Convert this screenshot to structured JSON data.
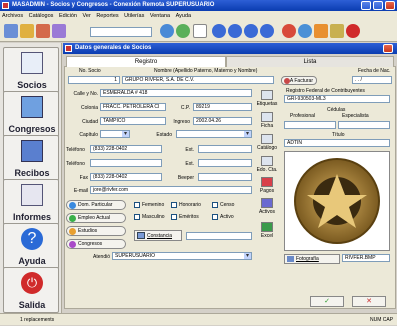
{
  "window": {
    "title": "MASADMIN - Socios y Congresos - Conexión Remota  SUPERUSUARIO"
  },
  "menu": [
    "Archivos",
    "Catálogos",
    "Edición",
    "Ver",
    "Reportes",
    "Utilerías",
    "Ventana",
    "Ayuda"
  ],
  "sidebar": [
    {
      "label": "Socios"
    },
    {
      "label": "Congresos"
    },
    {
      "label": "Recibos"
    },
    {
      "label": "Informes"
    },
    {
      "label": "Ayuda"
    },
    {
      "label": "Salida"
    }
  ],
  "dialog": {
    "title": "Datos generales de Socios"
  },
  "tabs": {
    "registro": "Registro",
    "lista": "Lista"
  },
  "form": {
    "no_socio_label": "No. Socio",
    "no_socio": "1",
    "nombre_label": "Nombre (Apellido Paterno, Materno y Nombre)",
    "nombre": "GRUPO RIVFER, S.A. DE C.V.",
    "a_facturar": "A Facturar",
    "fecha_nac_label": "Fecha de Nac.",
    "fecha_nac": ". . /",
    "calle_label": "Calle y No.",
    "calle": "ESMERALDA # 418",
    "colonia_label": "Colonia",
    "colonia": "FRACC. PETROLERA CI",
    "cp_label": "C.P.",
    "cp": "89219",
    "ciudad_label": "Ciudad",
    "ciudad": "TAMPICO",
    "ingreso_label": "Ingreso",
    "ingreso": "2002.04.26",
    "capitulo_label": "Capítulo",
    "estado_label": "Estado",
    "telefono_label": "Teléfono",
    "telefono": "(833) 228-0402",
    "ext_label": "Ext.",
    "telefono2_label": "Teléfono",
    "ext2_label": "Ext.",
    "fax_label": "Fax",
    "fax": "(833) 228-0402",
    "beeper_label": "Beeper",
    "email_label": "E-mail",
    "email": "jore@rivfer.com",
    "rfc_label": "Registro Federal de Contribuyentes",
    "rfc": "GRI-930503-ML3",
    "cedulas_label": "Cédulas",
    "profesional_label": "Profesional",
    "especialista_label": "Especialista",
    "titulo_label": "Título",
    "titulo": "ADTIN",
    "dom_particular": "Dom. Particular",
    "empleo_actual": "Empleo Actual",
    "estudios": "Estudios",
    "congresos": "Congresos",
    "femenino": "Femenino",
    "masculino": "Masculino",
    "honorario": "Honorario",
    "emeritos": "Eméritos",
    "censo": "Censo",
    "activo": "Activo",
    "constancia": "Constancia",
    "atendio_label": "Atendió",
    "atendio": "SUPERUSUARIO",
    "fotografia": "Fotografía",
    "foto_file": "RIVFER.BMP"
  },
  "side_buttons": {
    "etiquetas": "Etiquetas",
    "ficha": "Ficha",
    "catalogo": "Catálogo",
    "edo_cta": "Edo. Cta.",
    "pagos": "Pagos",
    "activos": "Activos",
    "excel": "Excel"
  },
  "footer": {
    "ok": "✓",
    "cancel": "✕"
  },
  "status": {
    "left": "1  replacements",
    "right": "NUM  CAP"
  }
}
